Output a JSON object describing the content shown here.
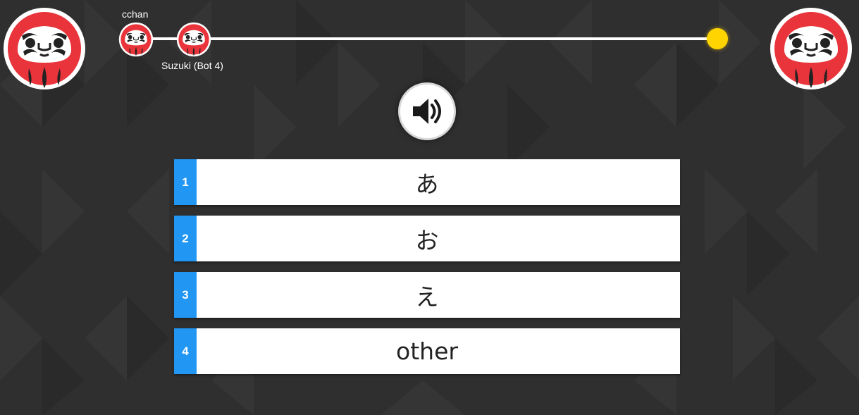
{
  "theme": {
    "background": "#2f2f2f",
    "track_color": "#ffffff",
    "goal_color": "#ffd400",
    "answer_number_color": "#2196f3",
    "daruma_red": "#e8343a"
  },
  "players": {
    "left_avatar": "daruma-icon",
    "right_avatar": "daruma-icon",
    "racers": [
      {
        "name": "cchan",
        "avatar": "daruma-icon"
      },
      {
        "name": "Suzuki (Bot 4)",
        "avatar": "daruma-icon"
      }
    ]
  },
  "sound_button": {
    "icon": "speaker-icon"
  },
  "answers": [
    {
      "number": "1",
      "text": "あ"
    },
    {
      "number": "2",
      "text": "お"
    },
    {
      "number": "3",
      "text": "え"
    },
    {
      "number": "4",
      "text": "other"
    }
  ]
}
